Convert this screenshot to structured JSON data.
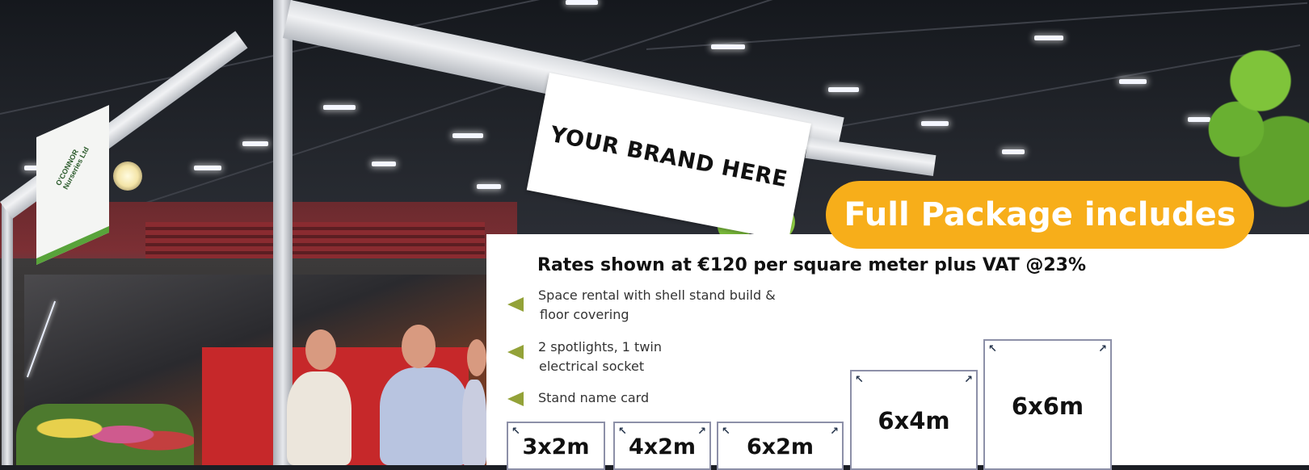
{
  "brand_sign": {
    "text": "YOUR BRAND HERE"
  },
  "banner": {
    "text": "Full Package includes",
    "color": "#f7ae1a"
  },
  "rates": {
    "text": "Rates shown at €120 per square meter plus VAT @23%"
  },
  "features": [
    {
      "line1": "Space rental with shell stand build &",
      "line2": "floor covering"
    },
    {
      "line1": "2 spotlights, 1 twin",
      "line2": "electrical socket"
    },
    {
      "line1": "Stand name card",
      "line2": ""
    }
  ],
  "sizes": [
    {
      "label": "3x2m"
    },
    {
      "label": "4x2m"
    },
    {
      "label": "6x2m"
    },
    {
      "label": "6x4m"
    },
    {
      "label": "6x6m"
    }
  ],
  "side_sign": {
    "text": "O'CONNOR Nurseries Ltd"
  },
  "colors": {
    "bullet": "#93a238",
    "box_border": "#8d90a8",
    "icon": "#27364d"
  }
}
